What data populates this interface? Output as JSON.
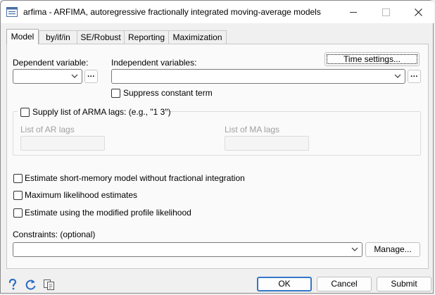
{
  "window": {
    "title": "arfima - ARFIMA, autoregressive fractionally integrated moving-average models"
  },
  "tabs": [
    {
      "label": "Model"
    },
    {
      "label": "by/if/in"
    },
    {
      "label": "SE/Robust"
    },
    {
      "label": "Reporting"
    },
    {
      "label": "Maximization"
    }
  ],
  "model": {
    "time_settings_label": "Time settings...",
    "dependent_label": "Dependent variable:",
    "dependent_value": "",
    "browse_label": "...",
    "independent_label": "Independent variables:",
    "independent_value": "",
    "suppress_constant_label": "Suppress constant term",
    "arma_group_label": "Supply list of ARMA lags: (e.g., \"1 3\")",
    "ar_lags_label": "List of AR lags",
    "ma_lags_label": "List of MA lags",
    "option1_label": "Estimate short-memory model without fractional integration",
    "option2_label": "Maximum likelihood estimates",
    "option3_label": "Estimate using the modified profile likelihood",
    "constraints_label": "Constraints: (optional)",
    "constraints_value": "",
    "manage_label": "Manage..."
  },
  "footer": {
    "ok_label": "OK",
    "cancel_label": "Cancel",
    "submit_label": "Submit"
  },
  "colors": {
    "accent": "#3477c8",
    "help_icon": "#2a6cc4"
  }
}
